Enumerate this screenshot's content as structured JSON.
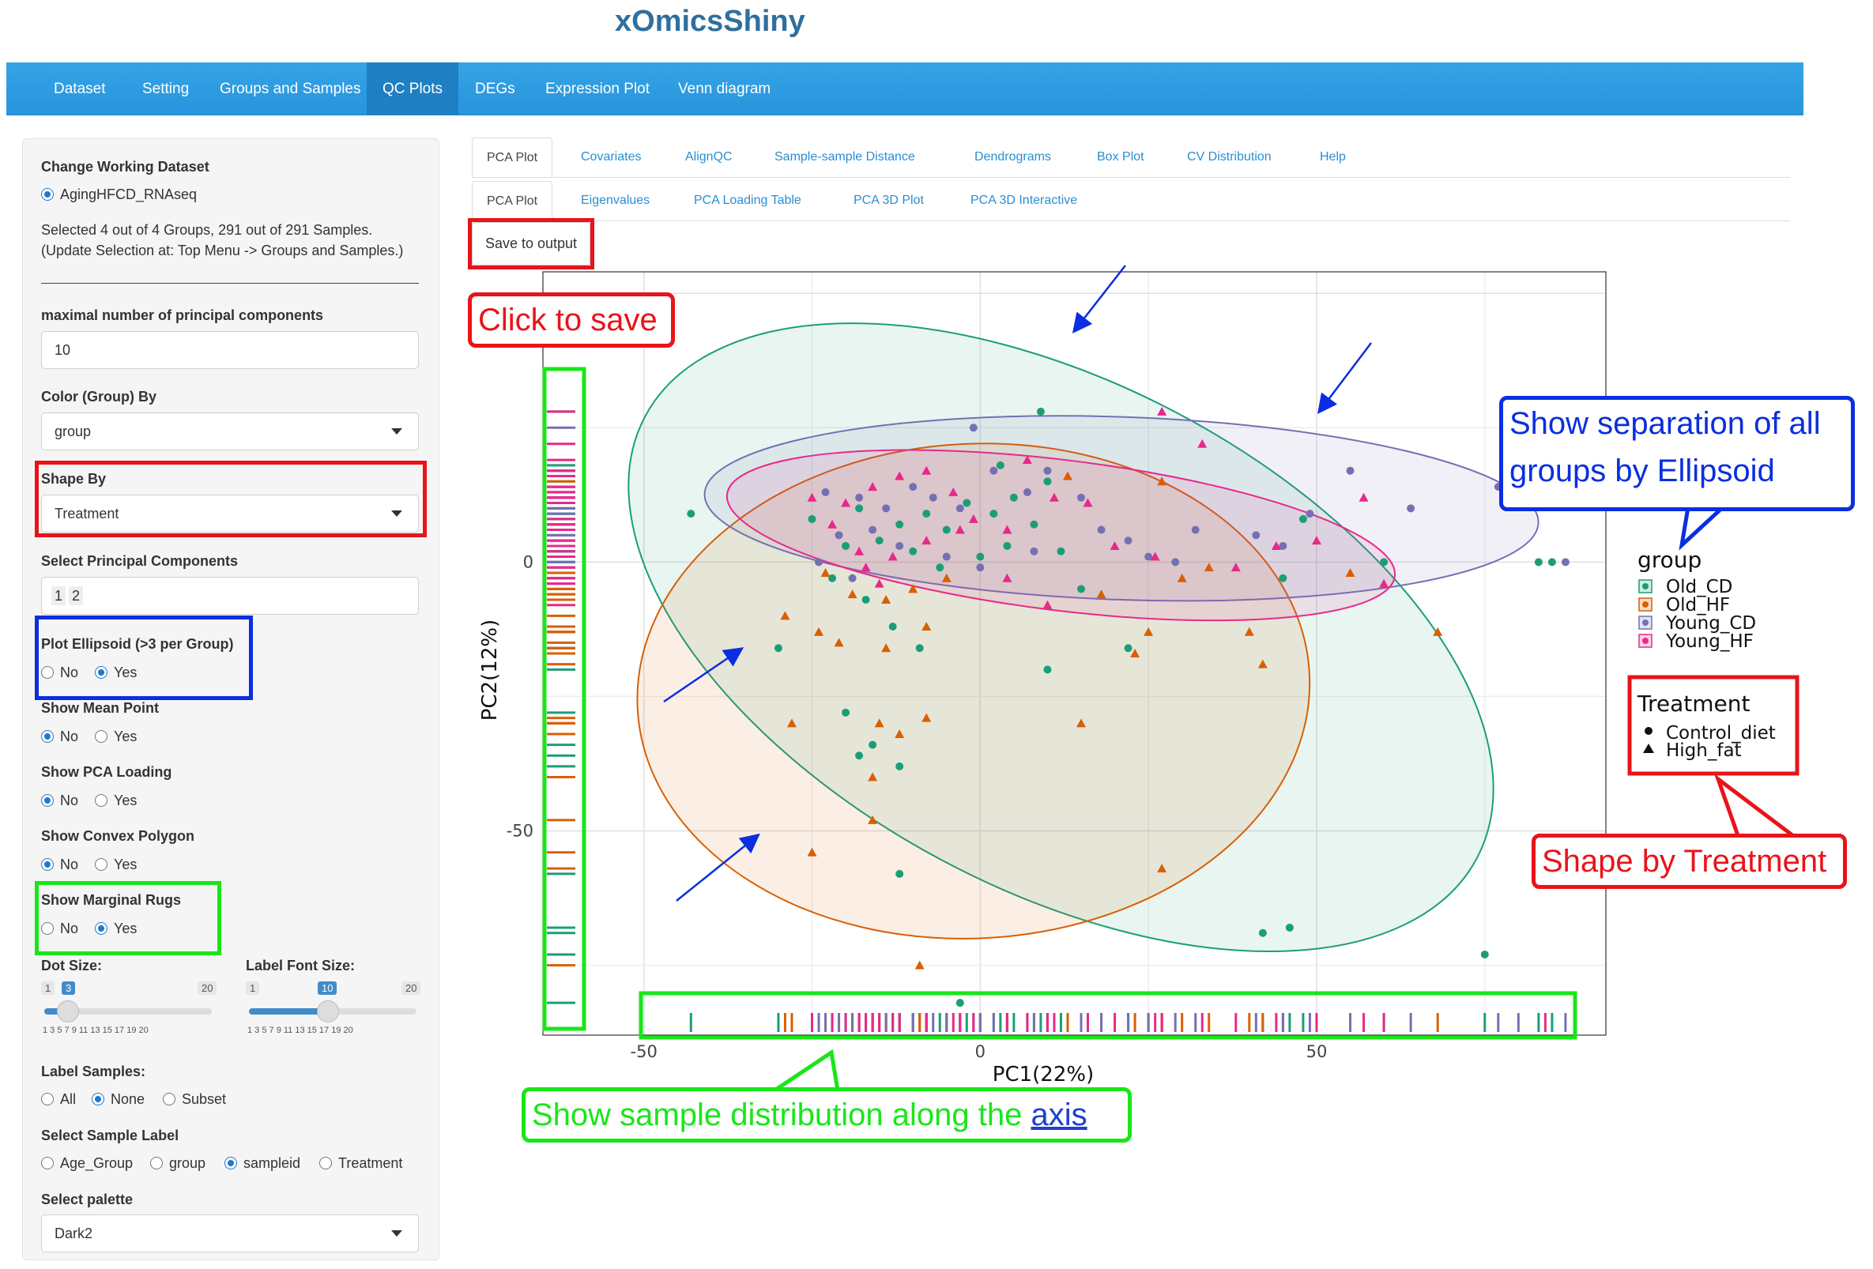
{
  "app": {
    "title": "xOmicsShiny"
  },
  "nav": {
    "items": [
      "Dataset",
      "Setting",
      "Groups and Samples",
      "QC Plots",
      "DEGs",
      "Expression Plot",
      "Venn diagram"
    ],
    "active": "QC Plots"
  },
  "sidebar": {
    "dataset_label": "Change Working Dataset",
    "dataset_option": "AgingHFCD_RNAseq",
    "selection_line1": "Selected 4 out of 4 Groups, 291 out of 291 Samples.",
    "selection_line2": "(Update Selection at: Top Menu -> Groups and Samples.)",
    "max_pc_label": "maximal number of principal components",
    "max_pc_value": "10",
    "color_by_label": "Color (Group) By",
    "color_by_value": "group",
    "shape_by_label": "Shape By",
    "shape_by_value": "Treatment",
    "select_pc_label": "Select Principal Components",
    "select_pc_values": [
      "1",
      "2"
    ],
    "ellipse_label": "Plot Ellipsoid (>3 per Group)",
    "mean_label": "Show Mean Point",
    "loading_label": "Show PCA Loading",
    "convex_label": "Show Convex Polygon",
    "rugs_label": "Show Marginal Rugs",
    "no": "No",
    "yes": "Yes",
    "dot_size_label": "Dot Size:",
    "dot_size": {
      "min": "1",
      "value": "3",
      "max": "20"
    },
    "font_size_label": "Label Font Size:",
    "font_size": {
      "min": "1",
      "value": "10",
      "max": "20"
    },
    "slider_ticks": "1   3   5   7   9  11  13  15  17  19 20",
    "label_samples_label": "Label Samples:",
    "label_samples_options": [
      "All",
      "None",
      "Subset"
    ],
    "sample_label_label": "Select Sample Label",
    "sample_label_options": [
      "Age_Group",
      "group",
      "sampleid",
      "Treatment"
    ],
    "palette_label": "Select palette",
    "palette_value": "Dark2"
  },
  "tabs_row1": [
    "PCA Plot",
    "Covariates",
    "AlignQC",
    "Sample-sample Distance",
    "Dendrograms",
    "Box Plot",
    "CV Distribution",
    "Help"
  ],
  "tabs_row2": [
    "PCA Plot",
    "Eigenvalues",
    "PCA Loading Table",
    "PCA 3D Plot",
    "PCA 3D Interactive"
  ],
  "save_button": "Save to output",
  "callouts": {
    "save": "Click to save",
    "ellipse_line1": "Show separation of all",
    "ellipse_line2": "groups by Ellipsoid",
    "shape": "Shape by Treatment",
    "rug": "Show sample distribution along the",
    "rug_link": "axis"
  },
  "colors": {
    "Old_CD": "#1b9e77",
    "Old_HF": "#d95f02",
    "Young_CD": "#7570b3",
    "Young_HF": "#e7298a"
  },
  "chart_data": {
    "type": "scatter",
    "xlabel": "PC1(22%)",
    "ylabel": "PC2(12%)",
    "xticks": [
      -50,
      0,
      50
    ],
    "yticks": [
      0,
      -50
    ],
    "xlim": [
      -65,
      93
    ],
    "ylim": [
      -88,
      54
    ],
    "grid": true,
    "legend_color_title": "group",
    "legend_shape_title": "Treatment",
    "series": [
      {
        "name": "Old_CD",
        "shape": "circle",
        "points": [
          [
            -43,
            9
          ],
          [
            -25,
            8
          ],
          [
            -18,
            10
          ],
          [
            -12,
            7
          ],
          [
            -8,
            9
          ],
          [
            -5,
            6
          ],
          [
            -2,
            11
          ],
          [
            2,
            9
          ],
          [
            5,
            12
          ],
          [
            8,
            7
          ],
          [
            10,
            15
          ],
          [
            -20,
            3
          ],
          [
            -15,
            4
          ],
          [
            -10,
            2
          ],
          [
            -6,
            -1
          ],
          [
            0,
            1
          ],
          [
            4,
            3
          ],
          [
            12,
            2
          ],
          [
            15,
            -5
          ],
          [
            -22,
            -3
          ],
          [
            -17,
            -7
          ],
          [
            -13,
            -12
          ],
          [
            -9,
            -16
          ],
          [
            -30,
            -16
          ],
          [
            -20,
            -28
          ],
          [
            -16,
            -34
          ],
          [
            -12,
            -38
          ],
          [
            -18,
            -36
          ],
          [
            10,
            -20
          ],
          [
            22,
            -16
          ],
          [
            45,
            -3
          ],
          [
            48,
            8
          ],
          [
            60,
            0
          ],
          [
            83,
            0
          ],
          [
            85,
            0
          ],
          [
            -12,
            -58
          ],
          [
            42,
            -69
          ],
          [
            46,
            -68
          ],
          [
            75,
            -73
          ],
          [
            -3,
            -82
          ],
          [
            9,
            28
          ],
          [
            3,
            18
          ]
        ]
      },
      {
        "name": "Old_HF",
        "shape": "triangle",
        "points": [
          [
            -23,
            -2
          ],
          [
            -19,
            -6
          ],
          [
            -14,
            -7
          ],
          [
            -10,
            -5
          ],
          [
            -5,
            -3
          ],
          [
            -24,
            -13
          ],
          [
            -14,
            -16
          ],
          [
            -8,
            -12
          ],
          [
            -29,
            -10
          ],
          [
            -21,
            -15
          ],
          [
            -28,
            -30
          ],
          [
            -15,
            -30
          ],
          [
            -12,
            -32
          ],
          [
            -16,
            -40
          ],
          [
            -8,
            -29
          ],
          [
            15,
            -30
          ],
          [
            -16,
            -48
          ],
          [
            -25,
            -54
          ],
          [
            -9,
            -75
          ],
          [
            27,
            -57
          ],
          [
            40,
            -13
          ],
          [
            42,
            -19
          ],
          [
            23,
            -17
          ],
          [
            25,
            -13
          ],
          [
            30,
            -3
          ],
          [
            55,
            -2
          ],
          [
            68,
            -13
          ],
          [
            27,
            15
          ],
          [
            34,
            -1
          ],
          [
            13,
            16
          ],
          [
            18,
            -6
          ]
        ]
      },
      {
        "name": "Young_CD",
        "shape": "circle",
        "points": [
          [
            -23,
            13
          ],
          [
            -18,
            12
          ],
          [
            -14,
            10
          ],
          [
            -10,
            14
          ],
          [
            -7,
            12
          ],
          [
            -3,
            10
          ],
          [
            -1,
            25
          ],
          [
            2,
            17
          ],
          [
            7,
            13
          ],
          [
            10,
            17
          ],
          [
            15,
            12
          ],
          [
            18,
            6
          ],
          [
            22,
            4
          ],
          [
            25,
            1
          ],
          [
            29,
            0
          ],
          [
            32,
            6
          ],
          [
            -21,
            5
          ],
          [
            -16,
            6
          ],
          [
            -12,
            3
          ],
          [
            -5,
            1
          ],
          [
            0,
            -1
          ],
          [
            8,
            2
          ],
          [
            -24,
            0
          ],
          [
            -19,
            -3
          ],
          [
            41,
            5
          ],
          [
            45,
            3
          ],
          [
            49,
            9
          ],
          [
            55,
            17
          ],
          [
            64,
            10
          ],
          [
            77,
            14
          ],
          [
            80,
            14
          ],
          [
            87,
            0
          ]
        ]
      },
      {
        "name": "Young_HF",
        "shape": "triangle",
        "points": [
          [
            -25,
            12
          ],
          [
            -20,
            11
          ],
          [
            -16,
            14
          ],
          [
            -12,
            16
          ],
          [
            -8,
            17
          ],
          [
            -4,
            13
          ],
          [
            -1,
            8
          ],
          [
            4,
            6
          ],
          [
            7,
            19
          ],
          [
            11,
            12
          ],
          [
            16,
            11
          ],
          [
            20,
            3
          ],
          [
            26,
            1
          ],
          [
            33,
            22
          ],
          [
            38,
            -1
          ],
          [
            44,
            3
          ],
          [
            50,
            4
          ],
          [
            57,
            12
          ],
          [
            84,
            14
          ],
          [
            -22,
            7
          ],
          [
            -18,
            2
          ],
          [
            -13,
            1
          ],
          [
            -8,
            4
          ],
          [
            -3,
            6
          ],
          [
            4,
            -3
          ],
          [
            10,
            -8
          ],
          [
            -15,
            -4
          ],
          [
            60,
            -4
          ],
          [
            27,
            28
          ],
          [
            -17,
            -1
          ]
        ]
      }
    ]
  }
}
